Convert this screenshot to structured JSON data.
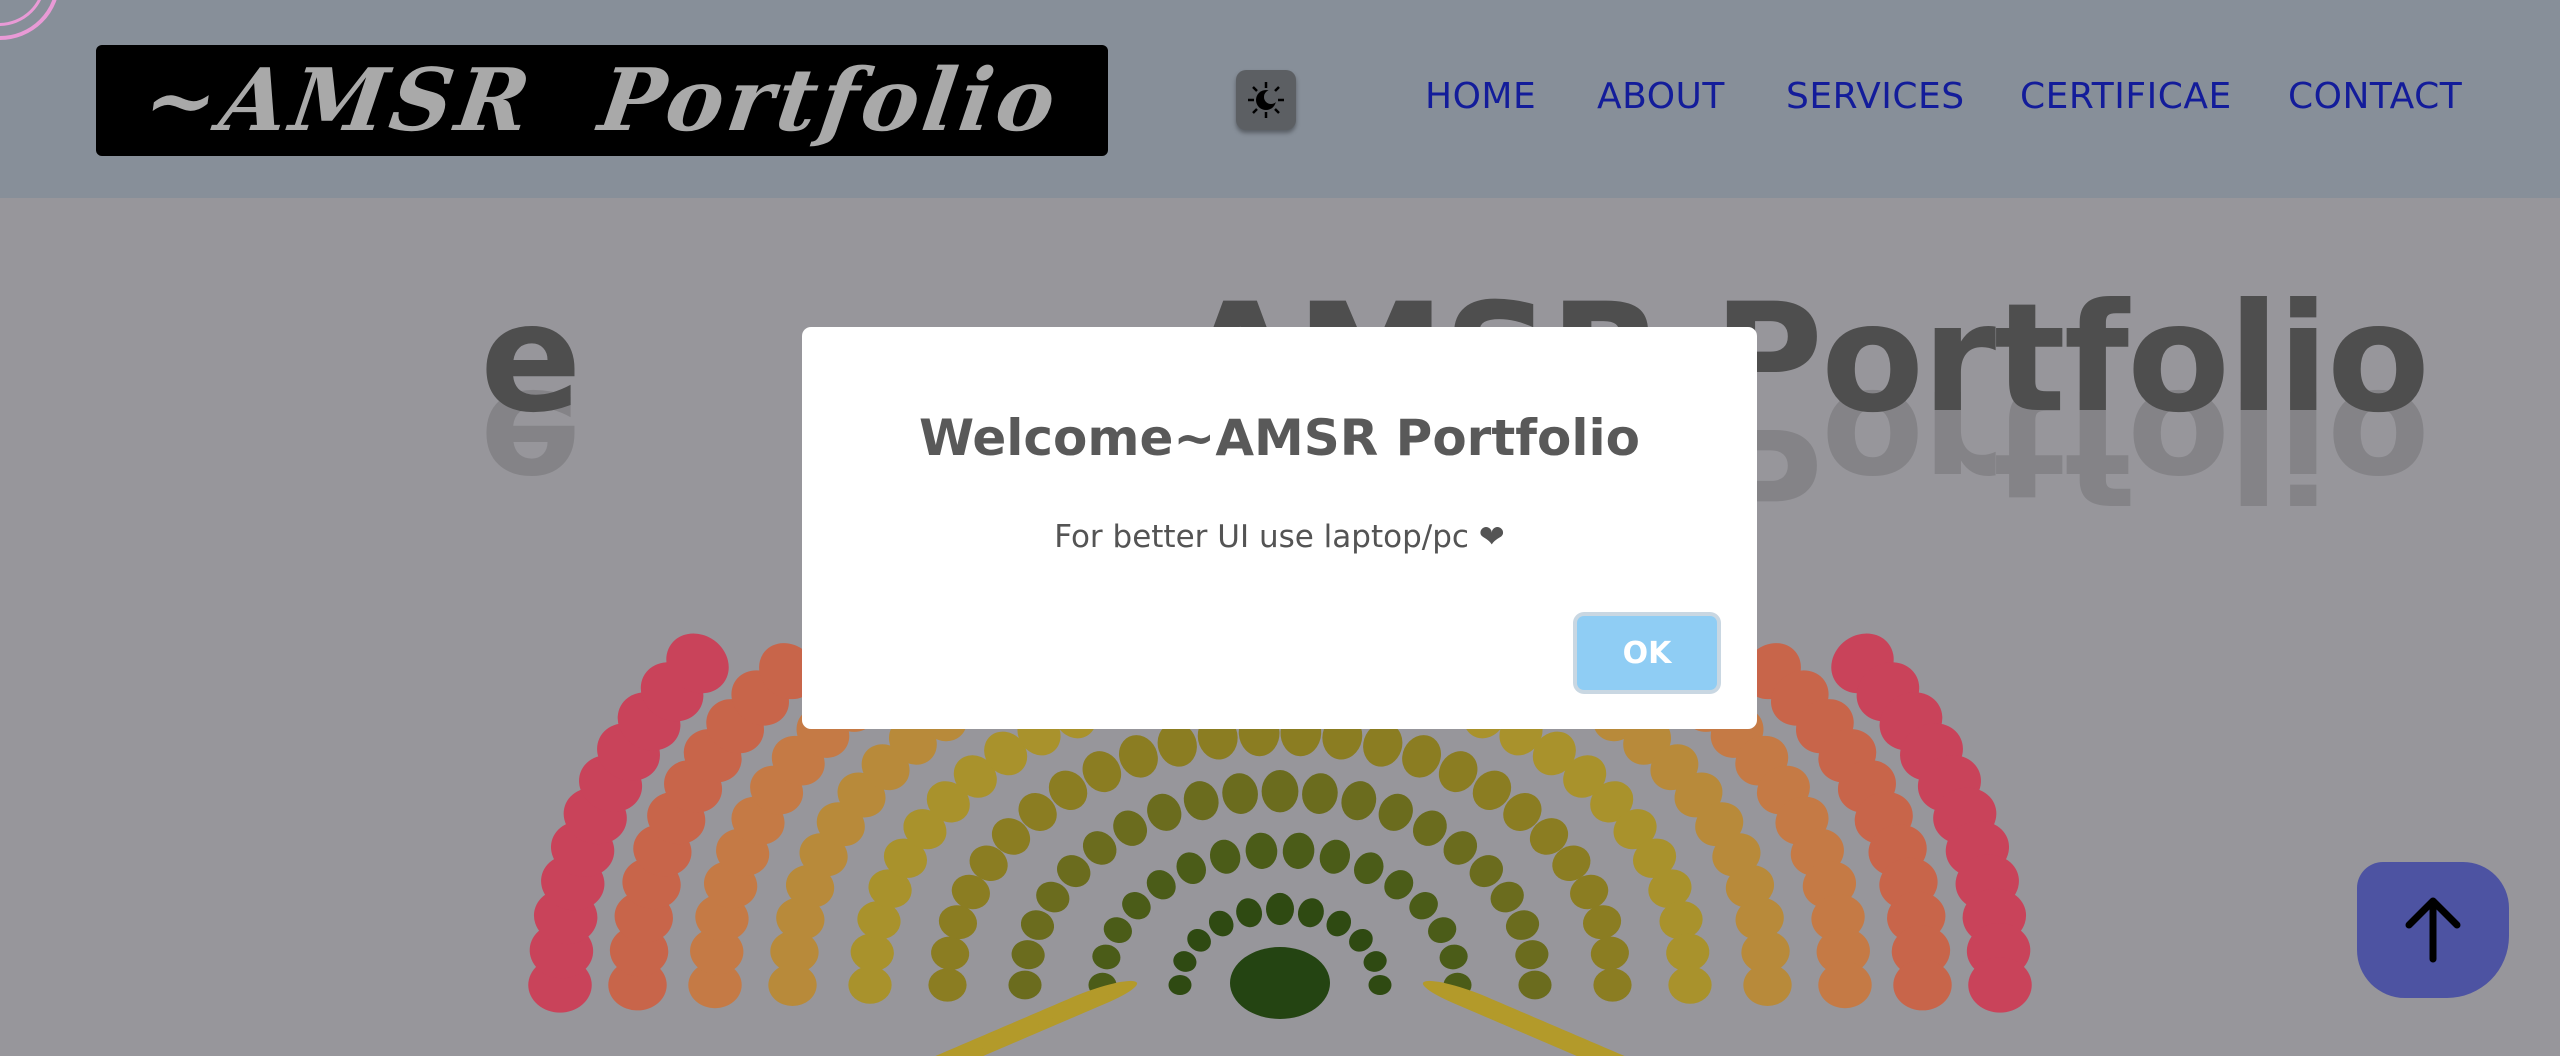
{
  "header": {
    "logo_text": "~AMSR  Portfolio",
    "theme_toggle_icon": "sun-moon-icon",
    "nav": [
      "HOME",
      "ABOUT",
      "SERVICES",
      "CERTIFICAE",
      "CONTACT"
    ]
  },
  "hero": {
    "title_left": "e",
    "title_right": "AMSR Portfolio"
  },
  "modal": {
    "title": "Welcome~AMSR Portfolio",
    "message": "For better UI use laptop/pc ❤",
    "ok_label": "OK"
  },
  "scroll_top": {
    "icon": "arrow-up-icon"
  },
  "colors": {
    "nav_bg": "#878f99",
    "page_bg": "#97969b",
    "nav_link": "#131c9a",
    "ok_button": "#8fcdf4",
    "scroll_button": "#4d53a2"
  }
}
